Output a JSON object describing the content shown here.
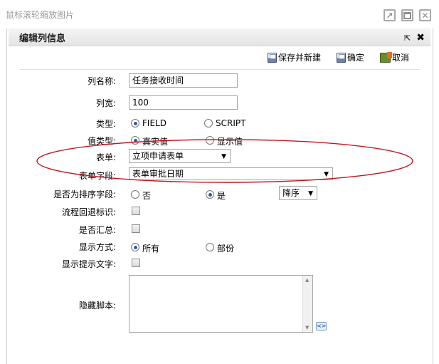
{
  "outer": {
    "title": "鼠标滚轮缩放图片"
  },
  "panel": {
    "title": "编辑列信息"
  },
  "toolbar": {
    "save_new": "保存并新建",
    "confirm": "确定",
    "cancel": "取消"
  },
  "form": {
    "column_name": {
      "label": "列名称:",
      "value": "任务接收时间"
    },
    "column_width": {
      "label": "列宽:",
      "value": "100"
    },
    "type": {
      "label": "类型:",
      "options": [
        "FIELD",
        "SCRIPT"
      ],
      "selected": "FIELD"
    },
    "value_type": {
      "label": "值类型:",
      "options": [
        "真实值",
        "显示值"
      ],
      "selected": "真实值"
    },
    "form_select": {
      "label": "表单:",
      "value": "立项申请表单"
    },
    "form_field": {
      "label": "表单字段:",
      "value": "表单审批日期"
    },
    "is_sort_field": {
      "label": "是否为排序字段:",
      "options": [
        "否",
        "是"
      ],
      "selected": "是",
      "order_value": "降序"
    },
    "flow_back_flag": {
      "label": "流程回退标识:"
    },
    "is_summary": {
      "label": "是否汇总:"
    },
    "display_mode": {
      "label": "显示方式:",
      "options": [
        "所有",
        "部份"
      ],
      "selected": "所有"
    },
    "show_tip_text": {
      "label": "显示提示文字:"
    },
    "hidden_script": {
      "label": "隐藏脚本:",
      "value": ""
    }
  },
  "colors": {
    "highlight_ellipse": "#c0191f",
    "radio_dot": "#2f5c9e"
  }
}
